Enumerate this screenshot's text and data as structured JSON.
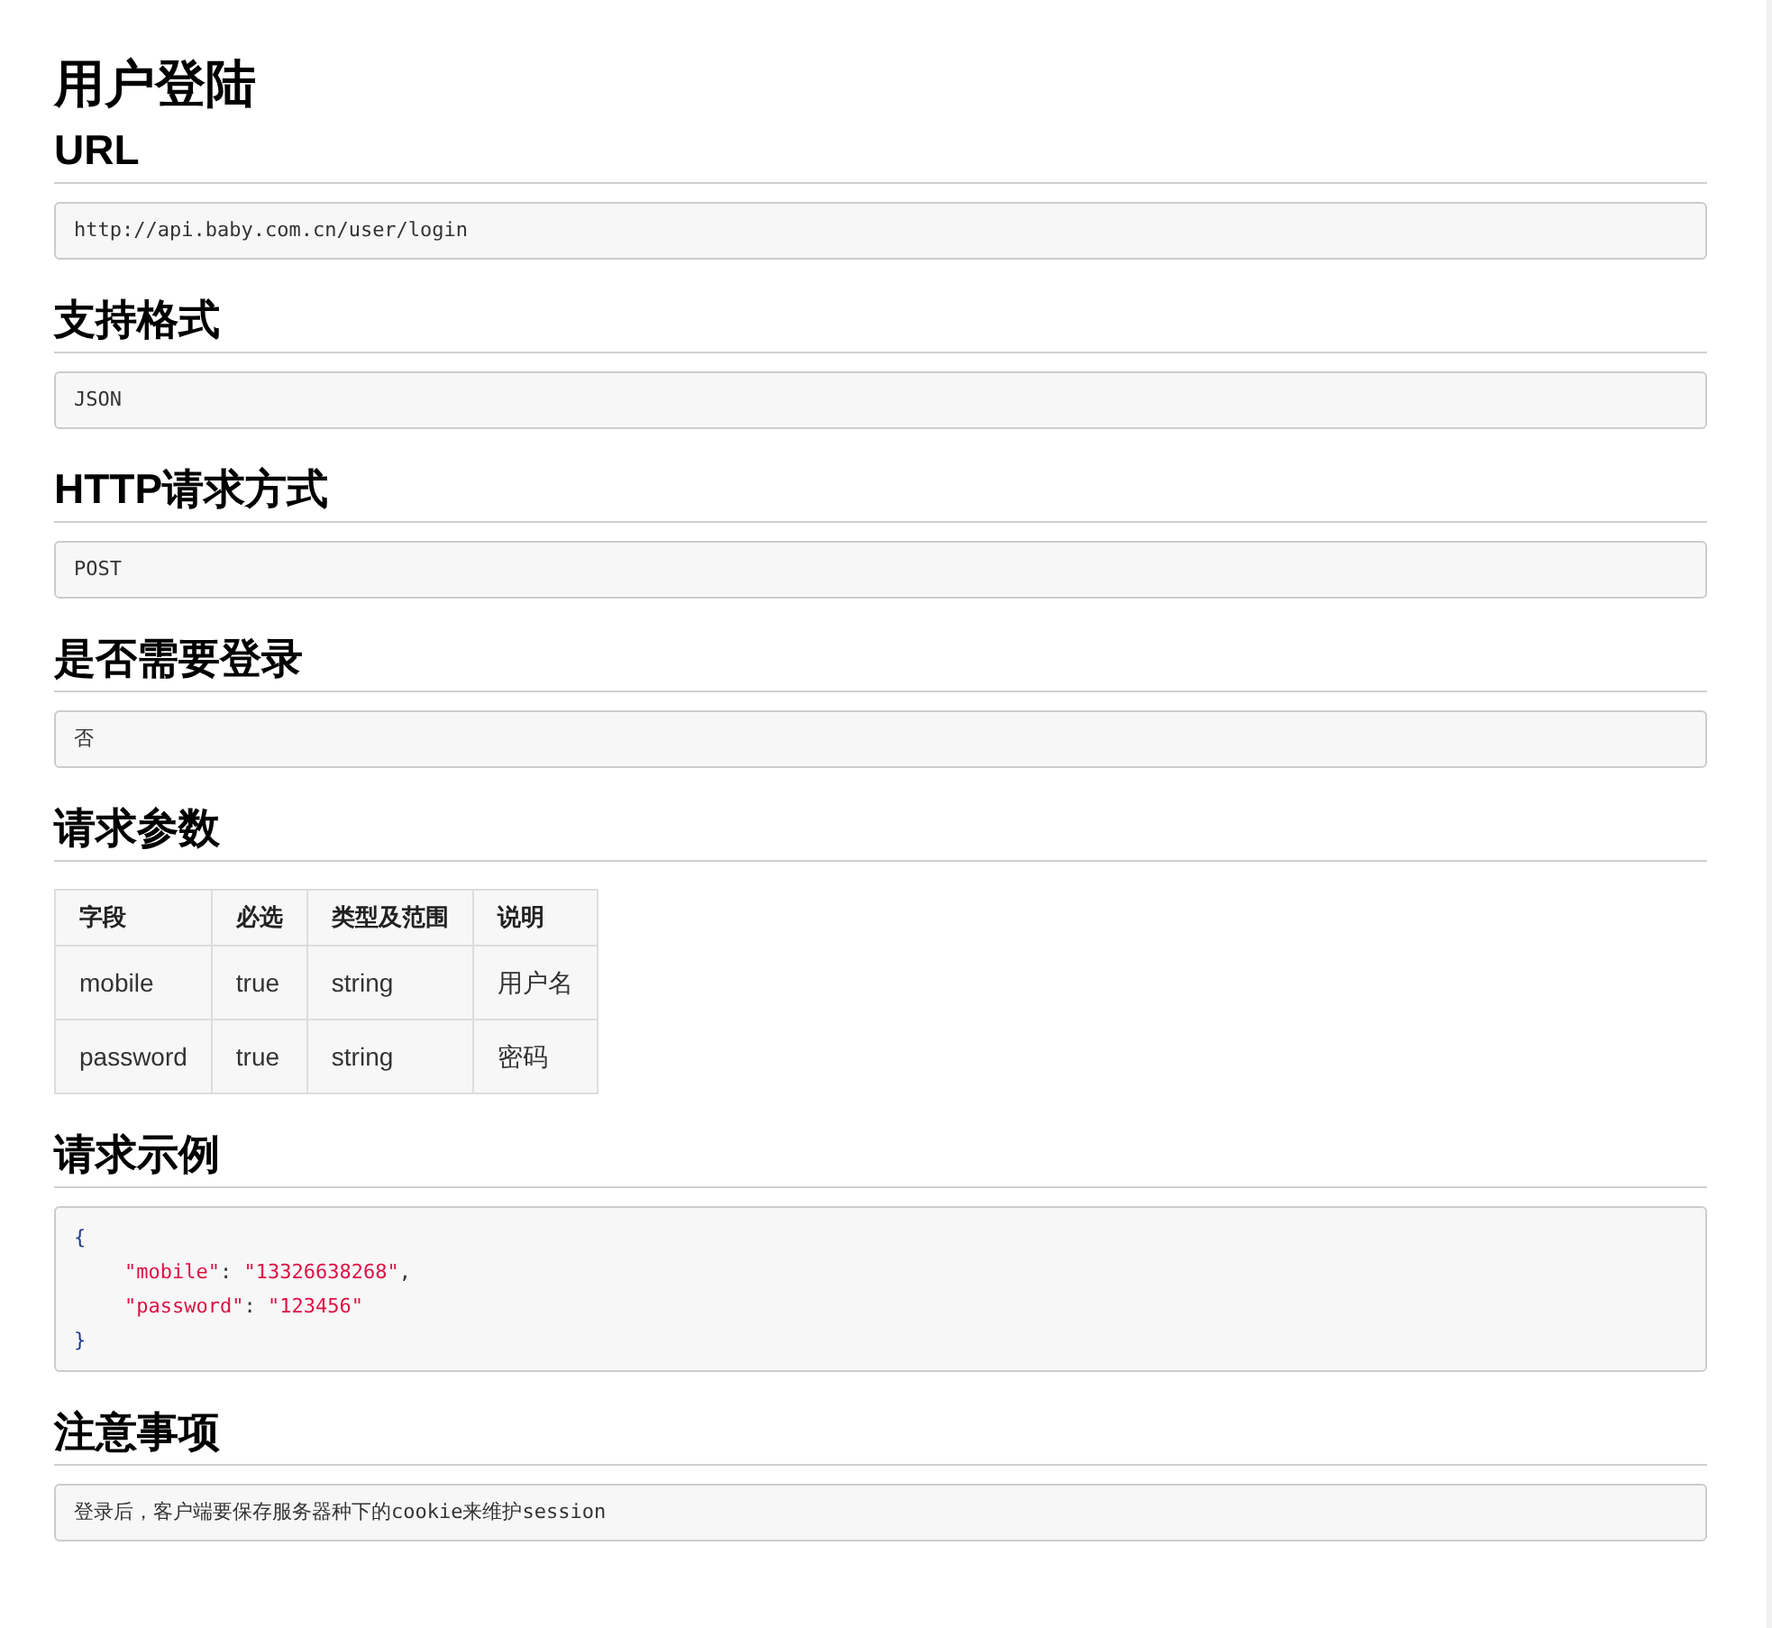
{
  "title": "用户登陆",
  "sections": [
    {
      "kind": "code",
      "heading": "URL",
      "text": "http://api.baby.com.cn/user/login"
    },
    {
      "kind": "code",
      "heading": "支持格式",
      "text": "JSON"
    },
    {
      "kind": "code",
      "heading": "HTTP请求方式",
      "text": "POST"
    },
    {
      "kind": "code",
      "heading": "是否需要登录",
      "text": "否"
    },
    {
      "kind": "table",
      "heading": "请求参数",
      "columns": [
        "字段",
        "必选",
        "类型及范围",
        "说明"
      ],
      "rows": [
        [
          "mobile",
          "true",
          "string",
          "用户名"
        ],
        [
          "password",
          "true",
          "string",
          "密码"
        ]
      ]
    },
    {
      "kind": "json",
      "heading": "请求示例",
      "lines": [
        {
          "indent": false,
          "tokens": [
            {
              "kind": "punct",
              "text": "{"
            }
          ]
        },
        {
          "indent": true,
          "tokens": [
            {
              "kind": "key",
              "text": "\"mobile\""
            },
            {
              "kind": "plain",
              "text": ": "
            },
            {
              "kind": "string",
              "text": "\"13326638268\""
            },
            {
              "kind": "plain",
              "text": ","
            }
          ]
        },
        {
          "indent": true,
          "tokens": [
            {
              "kind": "key",
              "text": "\"password\""
            },
            {
              "kind": "plain",
              "text": ": "
            },
            {
              "kind": "string",
              "text": "\"123456\""
            }
          ]
        },
        {
          "indent": false,
          "tokens": [
            {
              "kind": "punct",
              "text": "}"
            }
          ]
        }
      ]
    },
    {
      "kind": "code",
      "heading": "注意事项",
      "text": "登录后，客户端要保存服务器种下的cookie来维护session"
    }
  ]
}
